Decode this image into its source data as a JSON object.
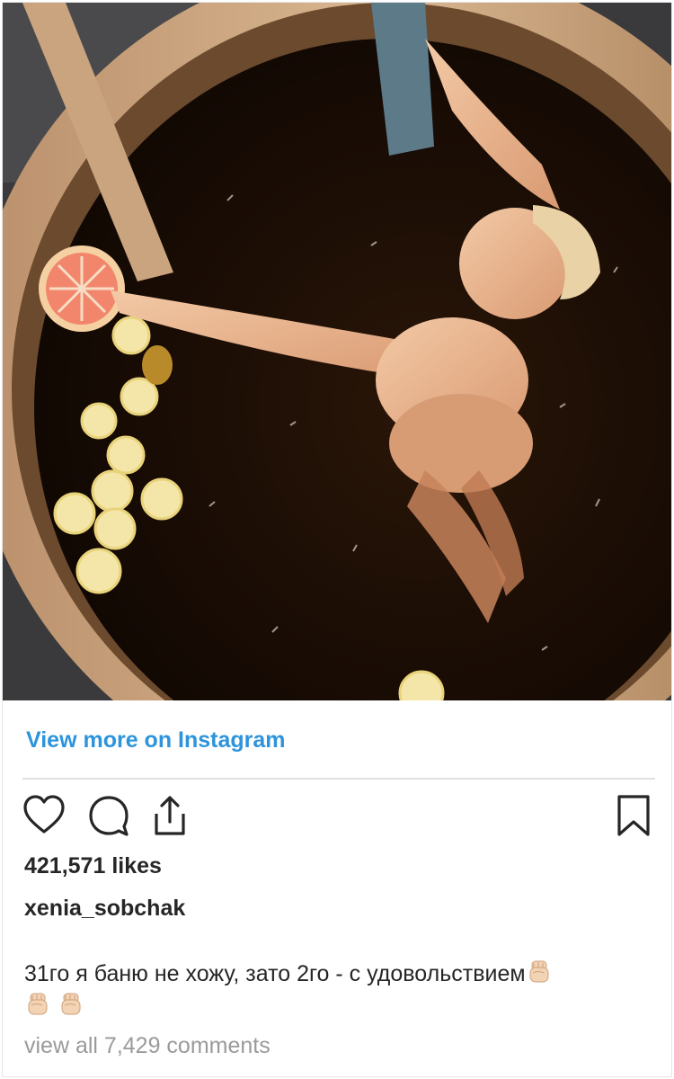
{
  "post": {
    "photo_icon": "bathing-photo",
    "view_more_label": "View more on Instagram",
    "likes_text": "421,571 likes",
    "username": "xenia_sobchak",
    "caption_text": "31го я баню не хожу, зато 2го - с удовольствием",
    "caption_emoji": [
      "raised-fist-icon",
      "raised-fist-icon",
      "raised-fist-icon"
    ],
    "comments_text": "view all 7,429 comments"
  },
  "actions": {
    "like_icon": "heart-icon",
    "comment_icon": "comment-icon",
    "share_icon": "share-icon",
    "save_icon": "bookmark-icon"
  },
  "colors": {
    "link": "#2d94dc",
    "text": "#262626",
    "muted": "#9a9a9a",
    "divider": "#e0e0e0"
  }
}
